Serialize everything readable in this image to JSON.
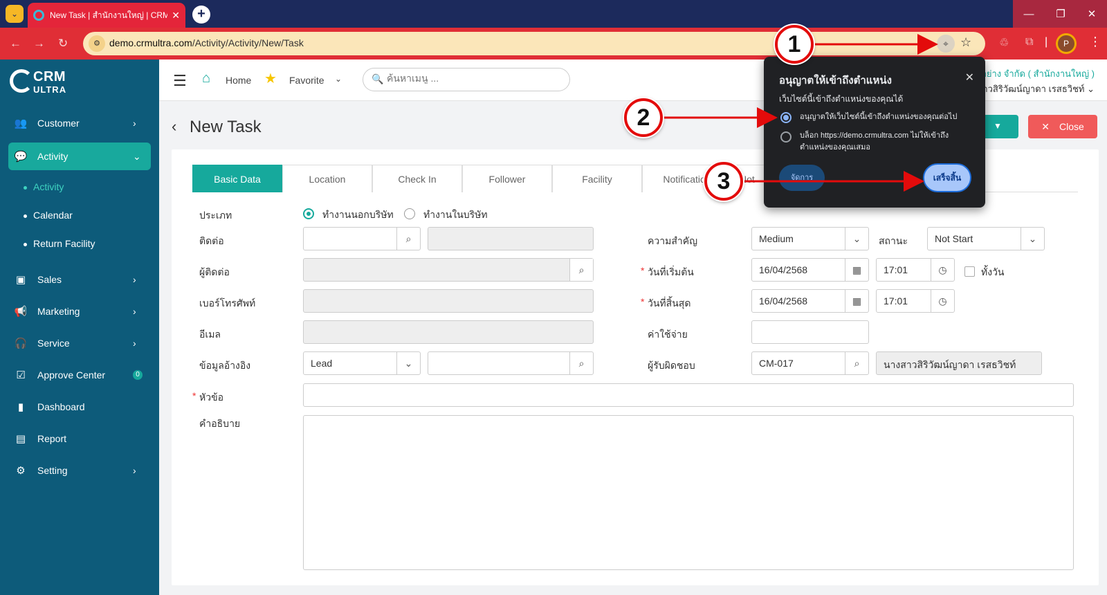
{
  "browser": {
    "tab_title": "New Task | สำนักงานใหญ่ | CRM U",
    "tab_close": "✕",
    "url_domain": "demo.crmultra.com",
    "url_path": "/Activity/Activity/New/Task",
    "profile_initial": "P"
  },
  "sidebar": {
    "logo_top": "CRM",
    "logo_bottom": "ULTRA",
    "items": [
      {
        "label": "Customer"
      },
      {
        "label": "Activity"
      },
      {
        "label": "Sales"
      },
      {
        "label": "Marketing"
      },
      {
        "label": "Service"
      },
      {
        "label": "Approve Center",
        "badge": "0"
      },
      {
        "label": "Dashboard"
      },
      {
        "label": "Report"
      },
      {
        "label": "Setting"
      }
    ],
    "sub_items": [
      {
        "label": "Activity"
      },
      {
        "label": "Calendar"
      },
      {
        "label": "Return Facility"
      }
    ]
  },
  "header": {
    "home": "Home",
    "favorite": "Favorite",
    "search_placeholder": "ค้นหาเมนู ...",
    "company": "อย่าง จำกัด ( สำนักงานใหญ่ )",
    "user": "าวสิริวัฒน์ญาดา เรสธวิชท์"
  },
  "page": {
    "title": "New Task",
    "close": "Close"
  },
  "tabs": [
    "Basic Data",
    "Location",
    "Check In",
    "Follower",
    "Facility",
    "Notification",
    "Not"
  ],
  "form": {
    "type_label": "ประเภท",
    "type_option1": "ทำงานนอกบริษัท",
    "type_option2": "ทำงานในบริษัท",
    "contact_label": "ติดต่อ",
    "contact_person_label": "ผู้ติดต่อ",
    "phone_label": "เบอร์โทรศัพท์",
    "email_label": "อีเมล",
    "reference_label": "ข้อมูลอ้างอิง",
    "reference_value": "Lead",
    "subject_label": "หัวข้อ",
    "description_label": "คำอธิบาย",
    "priority_label": "ความสำคัญ",
    "priority_value": "Medium",
    "status_label": "สถานะ",
    "status_value": "Not Start",
    "start_label": "วันที่เริ่มต้น",
    "start_date": "16/04/2568",
    "start_time": "17:01",
    "allday_label": "ทั้งวัน",
    "end_label": "วันที่สิ้นสุด",
    "end_date": "16/04/2568",
    "end_time": "17:01",
    "cost_label": "ค่าใช้จ่าย",
    "owner_label": "ผู้รับผิดชอบ",
    "owner_code": "CM-017",
    "owner_name": "นางสาวสิริวัฒน์ญาดา เรสธวิชท์"
  },
  "popup": {
    "title": "อนุญาตให้เข้าถึงตำแหน่ง",
    "subtitle": "เว็บไซต์นี้เข้าถึงตำแหน่งของคุณได้",
    "option_allow": "อนุญาตให้เว็บไซต์นี้เข้าถึงตำแหน่งของคุณต่อไป",
    "option_block": "บล็อก https://demo.crmultra.com ไม่ให้เข้าถึงตำแหน่งของคุณเสมอ",
    "manage": "จัดการ",
    "done": "เสร็จสิ้น"
  },
  "annotations": {
    "step1": "1",
    "step2": "2",
    "step3": "3",
    "color": "#e30b0b"
  }
}
